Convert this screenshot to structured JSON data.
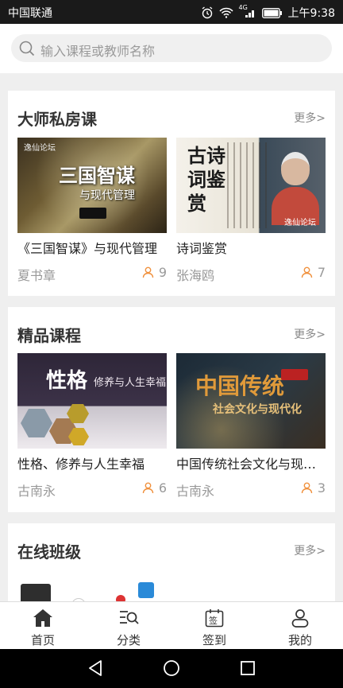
{
  "status_bar": {
    "carrier": "中国联通",
    "network": "4G",
    "time": "上午9:38"
  },
  "search": {
    "placeholder": "输入课程或教师名称"
  },
  "sections": {
    "master": {
      "title": "大师私房课",
      "more": "更多>",
      "courses": [
        {
          "title": "《三国智谋》与现代管理",
          "teacher": "夏书章",
          "count": "9",
          "thumb_text": "三国智谋",
          "thumb_sub": "与现代管理",
          "thumb_logo": "逸仙论坛"
        },
        {
          "title": "诗词鉴赏",
          "teacher": "张海鸥",
          "count": "7",
          "thumb_text": "古诗词鉴赏",
          "thumb_logo": "逸仙论坛"
        }
      ]
    },
    "premium": {
      "title": "精品课程",
      "more": "更多>",
      "courses": [
        {
          "title": "性格、修养与人生幸福",
          "teacher": "古南永",
          "count": "6",
          "thumb_text": "性格",
          "thumb_sub": "修养与人生幸福"
        },
        {
          "title": "中国传统社会文化与现代化",
          "teacher": "古南永",
          "count": "3",
          "thumb_text": "中国传统",
          "thumb_sub": "社会文化与现代化"
        }
      ]
    },
    "online": {
      "title": "在线班级",
      "more": "更多>"
    }
  },
  "tabs": [
    {
      "label": "首页",
      "icon": "home-icon",
      "active": true
    },
    {
      "label": "分类",
      "icon": "category-search-icon"
    },
    {
      "label": "签到",
      "icon": "checkin-calendar-icon",
      "icon_text": "签"
    },
    {
      "label": "我的",
      "icon": "user-icon"
    }
  ],
  "colors": {
    "accent_orange": "#f0903c",
    "text_dark": "#222222",
    "text_gray": "#999999",
    "status_bg": "#1a1a1a"
  }
}
